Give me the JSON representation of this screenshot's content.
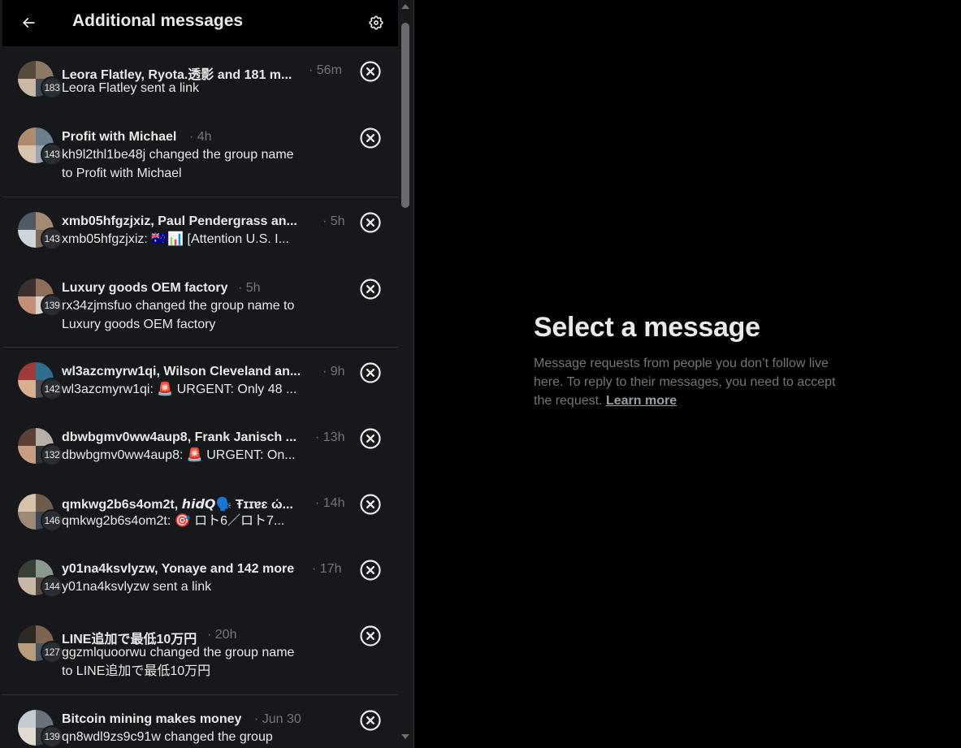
{
  "header": {
    "title": "Additional messages",
    "back_icon": "arrow-left-icon",
    "settings_icon": "gear-icon"
  },
  "conversations": [
    {
      "title": "Leora Flatley, Ryota.透影 and 181 m...",
      "time": "· 56m",
      "badge": "183",
      "preview": "Leora Flatley sent a link"
    },
    {
      "title": "Profit with Michael",
      "time": "· 4h",
      "badge": "143",
      "preview": "kh9l2thl1be48j changed the group name to Profit with Michael"
    },
    {
      "title": "xmb05hfgzjxiz, Paul Pendergrass an...",
      "time": "· 5h",
      "badge": "143",
      "preview": "xmb05hfgzjxiz: 🇦🇺📊 [Attention U.S. I..."
    },
    {
      "title": "Luxury goods OEM factory",
      "time": "· 5h",
      "badge": "139",
      "preview": "rx34zjmsfuo changed the group name to Luxury goods OEM factory"
    },
    {
      "title": "wl3azcmyrw1qi, Wilson Cleveland an...",
      "time": "· 9h",
      "badge": "142",
      "preview": "wl3azcmyrw1qi: 🚨 URGENT: Only 48 ..."
    },
    {
      "title": "dbwbgmv0ww4aup8, Frank Janisch ...",
      "time": "· 13h",
      "badge": "132",
      "preview": "dbwbgmv0ww4aup8: 🚨 URGENT: On..."
    },
    {
      "title": "qmkwg2b6s4om2t, 𝙝𝙞𝙙𝙌🗣️ Ŧɪɪɐɛ ώ...",
      "time": "· 14h",
      "badge": "146",
      "preview": "qmkwg2b6s4om2t: 🎯 ロト6／ロト7..."
    },
    {
      "title": "y01na4ksvlyzw, Yonaye and 142 more",
      "time": "· 17h",
      "badge": "144",
      "preview": "y01na4ksvlyzw sent a link"
    },
    {
      "title": "LINE追加で最低10万円",
      "time": "· 20h",
      "badge": "127",
      "preview": "ggzmlquoorwu changed the group name to LINE追加で最低10万円"
    },
    {
      "title": "Bitcoin mining makes money",
      "time": "· Jun 30",
      "badge": "139",
      "preview": "qn8wdl9zs9c91w changed the group"
    }
  ],
  "empty_state": {
    "title": "Select a message",
    "body": "Message requests from people you don’t follow live here. To reply to their messages, you need to accept the request.",
    "link": "Learn more"
  },
  "colors": {
    "panel_bg": "#16181c",
    "header_bg": "#000000",
    "text_primary": "#e7e9ea",
    "text_secondary": "#71767b",
    "divider": "#2f3336"
  }
}
